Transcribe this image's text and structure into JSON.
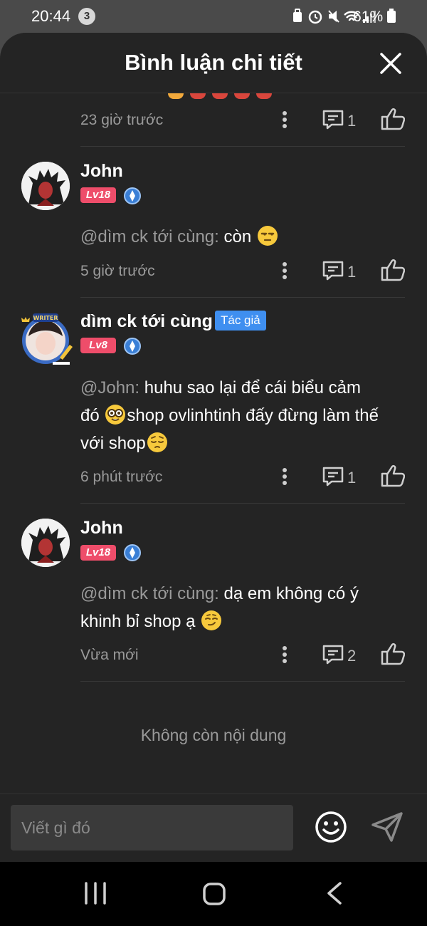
{
  "status_bar": {
    "time": "20:44",
    "notification_count": "3",
    "icons": "🔒⏰🔕📶",
    "battery": "61%"
  },
  "sheet": {
    "title": "Bình luận chi tiết"
  },
  "comments": [
    {
      "time": "23 giờ trước",
      "replies": "1"
    },
    {
      "name": "John",
      "level": "Lv18",
      "mention": "@dìm ck tới cùng:",
      "text": " còn ",
      "emoji": "unamused-face",
      "time": "5 giờ trước",
      "replies": "1"
    },
    {
      "name": "dìm ck tới cùng",
      "tag": "Tác giả",
      "level": "Lv8",
      "mention": "@John:",
      "text_a": " huhu sao lại để cái biểu cảm",
      "text_b": "đó ",
      "emoji_a": "nerd-face",
      "text_c": "shop ovlinhtinh đấy đừng làm thế",
      "text_d": "với shop",
      "emoji_b": "pensive-face",
      "time": "6 phút trước",
      "replies": "1"
    },
    {
      "name": "John",
      "level": "Lv18",
      "mention": "@dìm ck tới cùng:",
      "text_a": " dạ em không có ý",
      "text_b": "khinh bỉ shop ạ ",
      "emoji": "smirking-face",
      "time": "Vừa mới",
      "replies": "2"
    }
  ],
  "no_more": "Không còn nội dung",
  "composer": {
    "placeholder": "Viết gì đó"
  },
  "colors": {
    "sheet_bg": "#242424",
    "level_badge": "#ee4d6a",
    "author_tag": "#3f8ff0"
  }
}
